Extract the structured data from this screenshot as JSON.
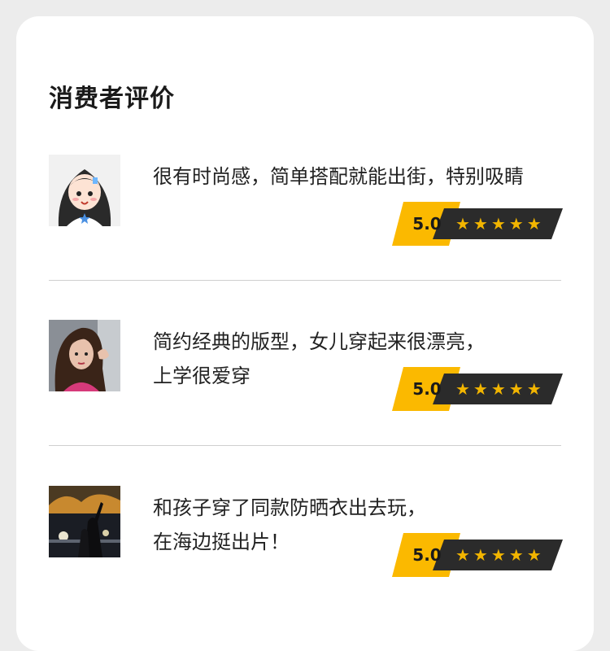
{
  "section": {
    "title": "消费者评价"
  },
  "colors": {
    "badge_yellow": "#fbb900",
    "badge_dark": "#2b2b2b",
    "star": "#f2b500"
  },
  "reviews": [
    {
      "avatar": "cartoon-girl-avatar",
      "text": "很有时尚感，简单搭配就能出街，特别吸睛",
      "score": "5.0",
      "stars": "★★★★★",
      "rating_value": 5
    },
    {
      "avatar": "woman-portrait-avatar",
      "text": "简约经典的版型，女儿穿起来很漂亮，\n上学很爱穿",
      "score": "5.0",
      "stars": "★★★★★",
      "rating_value": 5
    },
    {
      "avatar": "night-city-avatar",
      "text": "和孩子穿了同款防晒衣出去玩，\n在海边挺出片！",
      "score": "5.0",
      "stars": "★★★★★",
      "rating_value": 5
    }
  ]
}
